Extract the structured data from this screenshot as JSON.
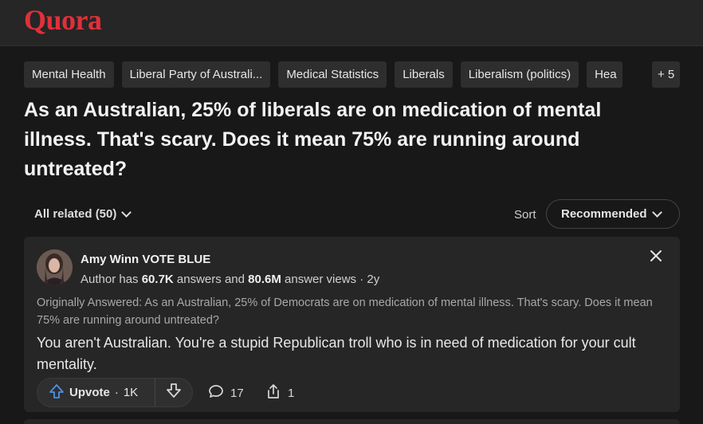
{
  "header": {
    "logo": "Quora",
    "brand_color": "#e0303a"
  },
  "topics": {
    "items": [
      {
        "label": "Mental Health"
      },
      {
        "label": "Liberal Party of Australi..."
      },
      {
        "label": "Medical Statistics"
      },
      {
        "label": "Liberals"
      },
      {
        "label": "Liberalism (politics)"
      },
      {
        "label": "Hea"
      }
    ],
    "more_label": "+ 5"
  },
  "question": {
    "title": "As an Australian, 25% of liberals are on medication of mental illness. That's scary. Does it mean 75% are running around untreated?"
  },
  "filters": {
    "related_label": "All related (50)",
    "sort_label": "Sort",
    "sort_value": "Recommended"
  },
  "answer": {
    "author_name": "Amy Winn VOTE BLUE",
    "meta_prefix": "Author has ",
    "answers_count": "60.7K",
    "meta_mid": " answers and ",
    "views_count": "80.6M",
    "meta_suffix": " answer views · 2y",
    "originally_answered": "Originally Answered: As an Australian, 25% of Democrats are on medication of mental illness. That's scary. Does it mean 75% are running around untreated?",
    "text": "You aren't Australian. You're a stupid Republican troll who is in need of medication for your cult mentality.",
    "upvote_label": "Upvote",
    "upvote_sep": "·",
    "upvote_count": "1K",
    "comment_count": "17",
    "share_count": "1",
    "upvote_color": "#4d8fe6"
  }
}
